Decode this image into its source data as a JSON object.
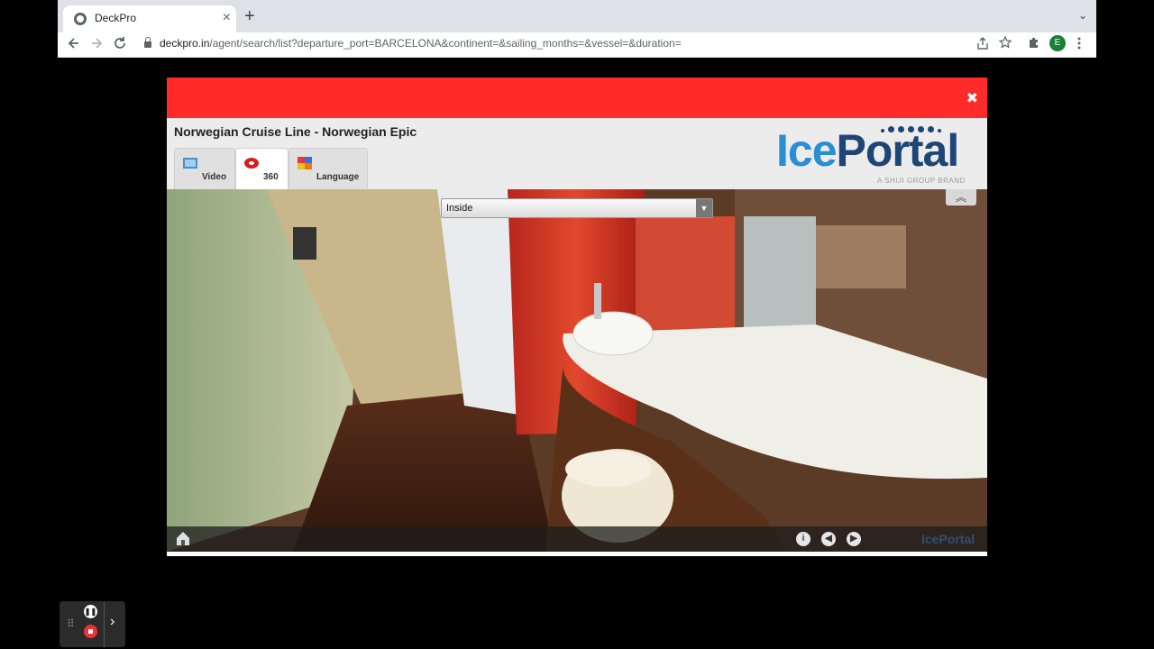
{
  "browser": {
    "tab_title": "DeckPro",
    "new_tab": "+",
    "tab_close": "×",
    "tab_menu": "⌄",
    "url_domain": "deckpro.in",
    "url_rest": "/agent/search/list?departure_port=BARCELONA&continent=&sailing_months=&vessel=&duration=",
    "avatar_letter": "E",
    "icons": [
      "back-icon",
      "forward-icon",
      "reload-icon",
      "lock-icon",
      "share-icon",
      "star-icon",
      "extensions-icon",
      "menu-icon"
    ]
  },
  "modal": {
    "title": "Norwegian Cruise Line - Norwegian Epic",
    "close_glyph": "✖",
    "tabs": [
      {
        "label": "Video",
        "icon": "video-icon"
      },
      {
        "label": "360",
        "icon": "panorama-icon"
      },
      {
        "label": "Language",
        "icon": "language-icon"
      }
    ],
    "active_tab": "360",
    "logo": {
      "part1": "Ice",
      "part2": "Portal",
      "tagline": "A SHIJI GROUP BRAND"
    },
    "colors": {
      "bar": "#ff2a2a",
      "logo_light": "#2a8fd0",
      "logo_dark": "#1e4575"
    }
  },
  "viewer": {
    "scene_select": {
      "value": "Inside"
    },
    "controls": {
      "info": "i",
      "prev": "◀",
      "next": "▶",
      "watermark": "IcePortal"
    }
  },
  "recorder": {
    "icons": [
      "drag-handle-icon",
      "pause-icon",
      "stop-icon",
      "expand-icon"
    ]
  }
}
